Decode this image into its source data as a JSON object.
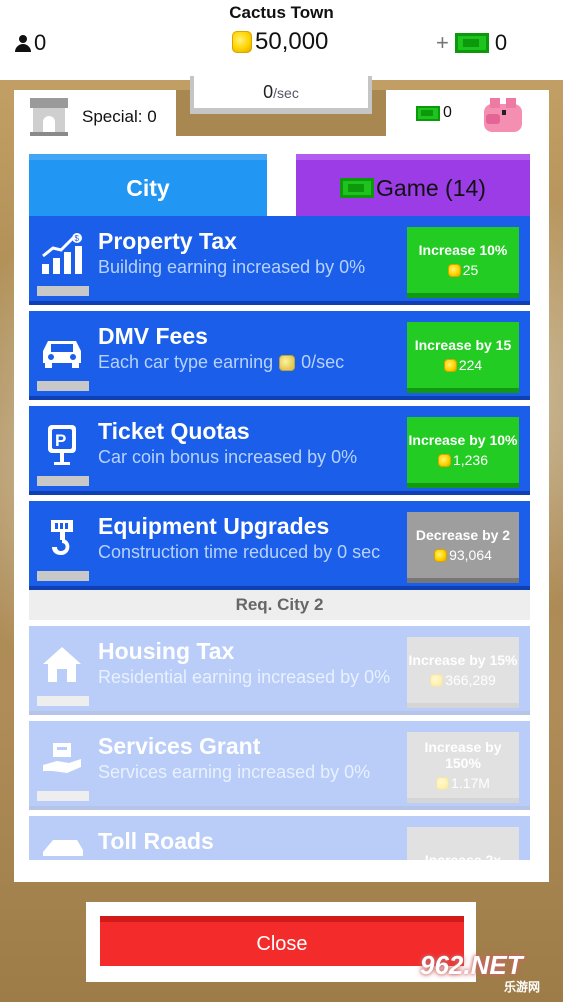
{
  "header": {
    "town_name": "Cactus Town",
    "population": "0",
    "coins": "50,000",
    "plus": "+",
    "cash": "0",
    "rate_value": "0",
    "rate_unit": "/sec"
  },
  "panel": {
    "special_label": "Special: 0",
    "cash_bank": "0",
    "tabs": {
      "city": "City",
      "game": "Game (14)"
    }
  },
  "upgrades": [
    {
      "title": "Property Tax",
      "desc": "Building earning increased by 0%",
      "button": "Increase 10%",
      "cost": "25",
      "state": "available",
      "icon": "chart-icon"
    },
    {
      "title": "DMV Fees",
      "desc": "Each car type earning",
      "desc_suffix": "0/sec",
      "button": "Increase by 15",
      "cost": "224",
      "state": "available",
      "icon": "car-icon"
    },
    {
      "title": "Ticket Quotas",
      "desc": "Car coin bonus increased by 0%",
      "button": "Increase by 10%",
      "cost": "1,236",
      "state": "available",
      "icon": "parking-sign-icon"
    },
    {
      "title": "Equipment Upgrades",
      "desc": "Construction time reduced by 0 sec",
      "button": "Decrease by 2",
      "cost": "93,064",
      "state": "unaffordable",
      "icon": "crane-hook-icon"
    }
  ],
  "req_city": "Req. City 2",
  "locked_upgrades": [
    {
      "title": "Housing Tax",
      "desc": "Residential earning increased by 0%",
      "button": "Increase by 15%",
      "cost": "366,289",
      "icon": "house-icon"
    },
    {
      "title": "Services Grant",
      "desc": "Services earning increased by 0%",
      "button": "Increase by 150%",
      "cost": "1.17M",
      "icon": "hand-box-icon"
    },
    {
      "title": "Toll Roads",
      "desc": "",
      "button": "Increase 2x",
      "cost": "",
      "icon": "toll-icon"
    }
  ],
  "close_label": "Close",
  "watermark": {
    "main": "962.NET",
    "sub": "乐游网"
  },
  "colors": {
    "city_tab": "#2196f3",
    "game_tab": "#9b3ce6",
    "row_blue": "#1a5eea",
    "buy_green": "#22cc22",
    "disabled_grey": "#9e9e9e",
    "close_red": "#f32b2b"
  }
}
